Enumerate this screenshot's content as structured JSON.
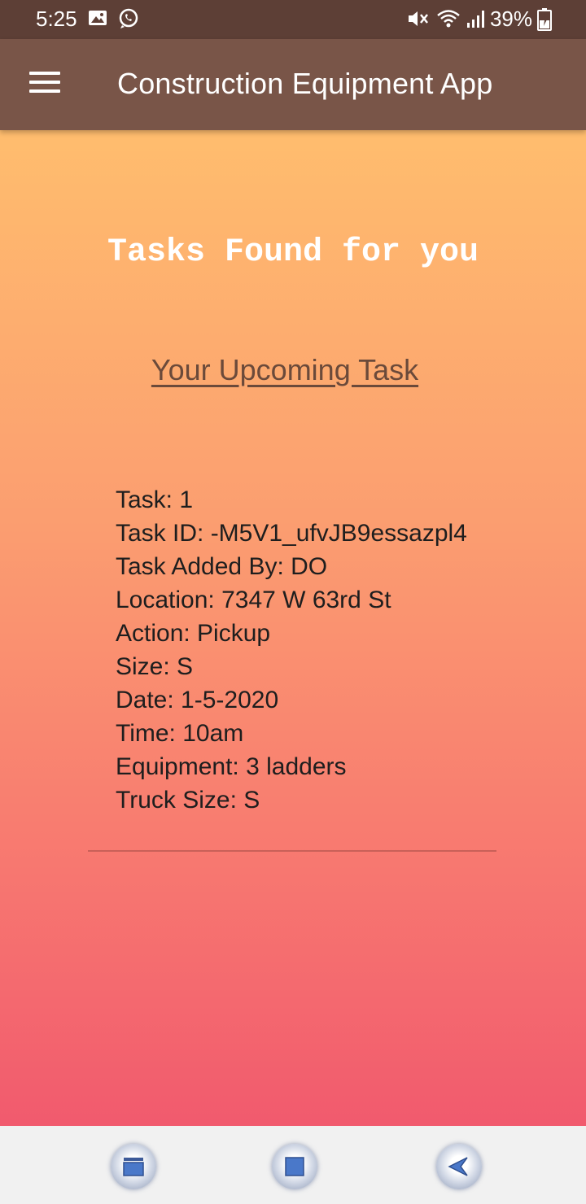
{
  "status_bar": {
    "time": "5:25",
    "battery": "39%",
    "icons": [
      "gallery-icon",
      "whatsapp-icon",
      "mute-icon",
      "wifi-icon",
      "signal-icon",
      "battery-charging-icon"
    ]
  },
  "app_bar": {
    "title": "Construction Equipment App",
    "menu_icon": "hamburger-menu-icon"
  },
  "main": {
    "heading": "Tasks Found for you",
    "subheading": "Your Upcoming Task",
    "task": {
      "number": "Task: 1",
      "id": "Task ID: -M5V1_ufvJB9essazpl4",
      "added_by": "Task Added By: DO",
      "location": "Location: 7347 W 63rd St",
      "action": "Action: Pickup",
      "size": "Size: S",
      "date": "Date: 1-5-2020",
      "time": "Time: 10am",
      "equipment": "Equipment: 3 ladders",
      "truck_size": "Truck Size: S"
    }
  },
  "colors": {
    "status_bar": "#5d3f36",
    "app_bar": "#795548",
    "gradient_top": "#ffbd6e",
    "gradient_bottom": "#f15a6e",
    "subheading": "#6b4a3a"
  },
  "nav_bar": {
    "buttons": [
      "recent-apps-icon",
      "home-icon",
      "back-icon"
    ]
  }
}
